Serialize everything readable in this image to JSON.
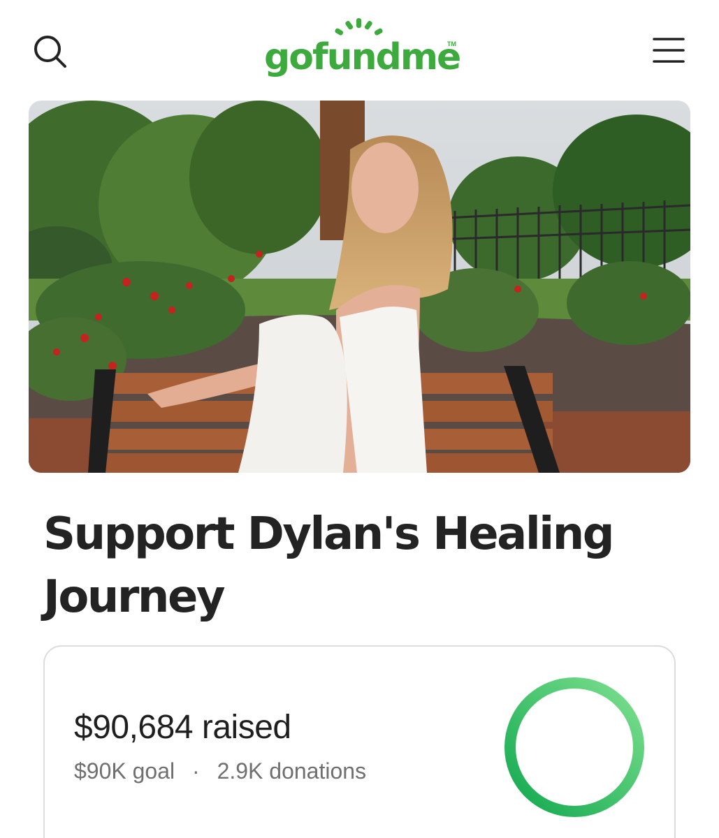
{
  "header": {
    "logo_text": "gofundme",
    "logo_tm": "TM",
    "search_icon": "search-icon",
    "menu_icon": "hamburger-menu-icon",
    "brand_color": "#3daa3d"
  },
  "hero": {
    "image": "woman-in-white-dress-on-park-bench-photo"
  },
  "campaign": {
    "title": "Support Dylan's Healing Journey"
  },
  "progress": {
    "raised_text": "$90,684 raised",
    "goal_text": "$90K goal",
    "separator": "·",
    "donations_text": "2.9K donations",
    "fraction": 1.0,
    "ring_color_start": "#11a84f",
    "ring_color_end": "#7ee08f"
  }
}
